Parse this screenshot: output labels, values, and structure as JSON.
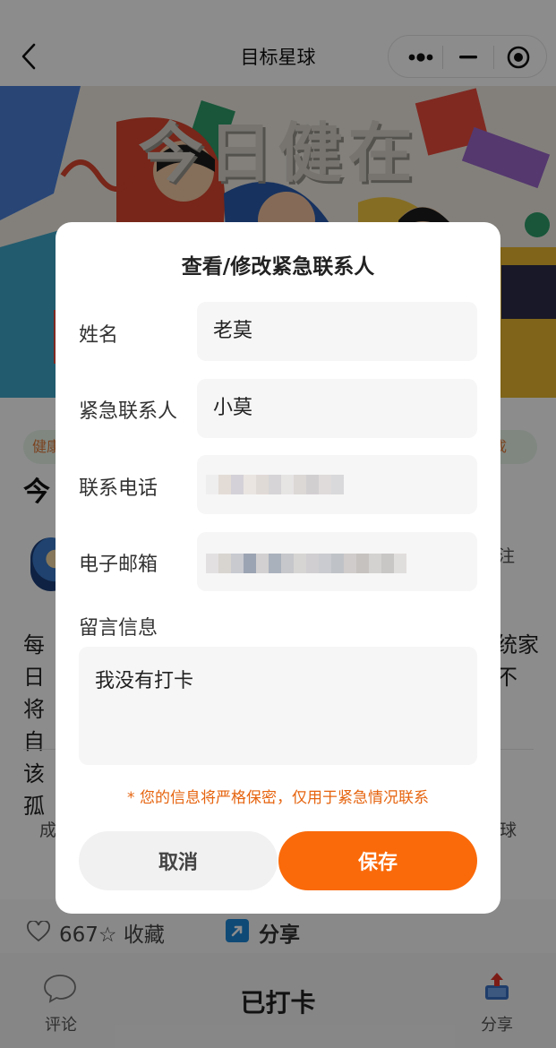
{
  "navbar": {
    "title": "目标星球",
    "icons": [
      "back-icon",
      "more-dots-icon",
      "minimize-icon",
      "close-target-icon"
    ]
  },
  "banner": {
    "title": "今日健在"
  },
  "background": {
    "tag_left": "健康",
    "tag_right": "成",
    "heading_fragment": "今",
    "follow_fragment": "注",
    "paragraph_left": "每日将自该孤",
    "paragraph_right": "统家不",
    "stat_left": "成",
    "stat_right": "球",
    "like_count": "667☆ 收藏",
    "share_label": "分享",
    "tabbar": {
      "comment_label": "评论",
      "checked_label": "已打卡",
      "share_label": "分享"
    }
  },
  "modal": {
    "title": "查看/修改紧急联系人",
    "fields": [
      {
        "label": "姓名",
        "value": "老莫"
      },
      {
        "label": "紧急联系人",
        "value": "小莫"
      },
      {
        "label": "联系电话",
        "value": ""
      },
      {
        "label": "电子邮箱",
        "value": ""
      }
    ],
    "message_label": "留言信息",
    "message_value": "我没有打卡",
    "notice": "* 您的信息将严格保密，仅用于紧急情况联系",
    "cancel_label": "取消",
    "save_label": "保存"
  },
  "colors": {
    "accent": "#fa6a0a",
    "notice": "#e6640f",
    "field_bg": "#f6f6f6"
  }
}
